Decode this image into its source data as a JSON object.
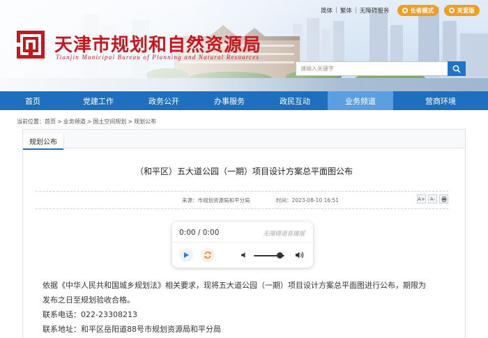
{
  "top_links": {
    "simplified": "简体",
    "traditional": "繁体",
    "accessible": "无障碍服务",
    "elder_mode": "长者模式",
    "care_version": "关爱版"
  },
  "brand": {
    "title": "天津市规划和自然资源局",
    "subtitle": "Tianjin Municipal Bureau of Planning and Natural Resources",
    "accent": "#c8161d"
  },
  "search": {
    "placeholder": "请输入关键字"
  },
  "nav": {
    "items": [
      "首页",
      "党建工作",
      "政务公开",
      "办事服务",
      "政民互动",
      "业务频道",
      "营商环境"
    ],
    "active_index": 5,
    "color": "#1e6fbe"
  },
  "breadcrumb": {
    "prefix": "当前位置：",
    "items": [
      "首页",
      "业务频道",
      "国土空间规划",
      "规划公布"
    ]
  },
  "tab": {
    "label": "规划公布"
  },
  "article": {
    "title": "（和平区）五大道公园（一期）项目设计方案总平面图公布",
    "source": "来源：市规划资源局和平分局",
    "time": "时间：2023-08-10 16:51",
    "tools": [
      "A+",
      "A-",
      "print-icon"
    ]
  },
  "player": {
    "time": "0:00 / 0:00",
    "label": "无障碍语音播报",
    "volume": 0.85
  },
  "body": {
    "para1_line1": "依据《中华人民共和国城乡规划法》相关要求，现将五大道公园（一期）项目设计方案总平面图进行公布，期限为",
    "para1_line2": "发布之日至规划验收合格。",
    "phone": "联系电话：022-23308213",
    "address": "联系地址：和平区岳阳道88号市规划资源局和平分局"
  }
}
